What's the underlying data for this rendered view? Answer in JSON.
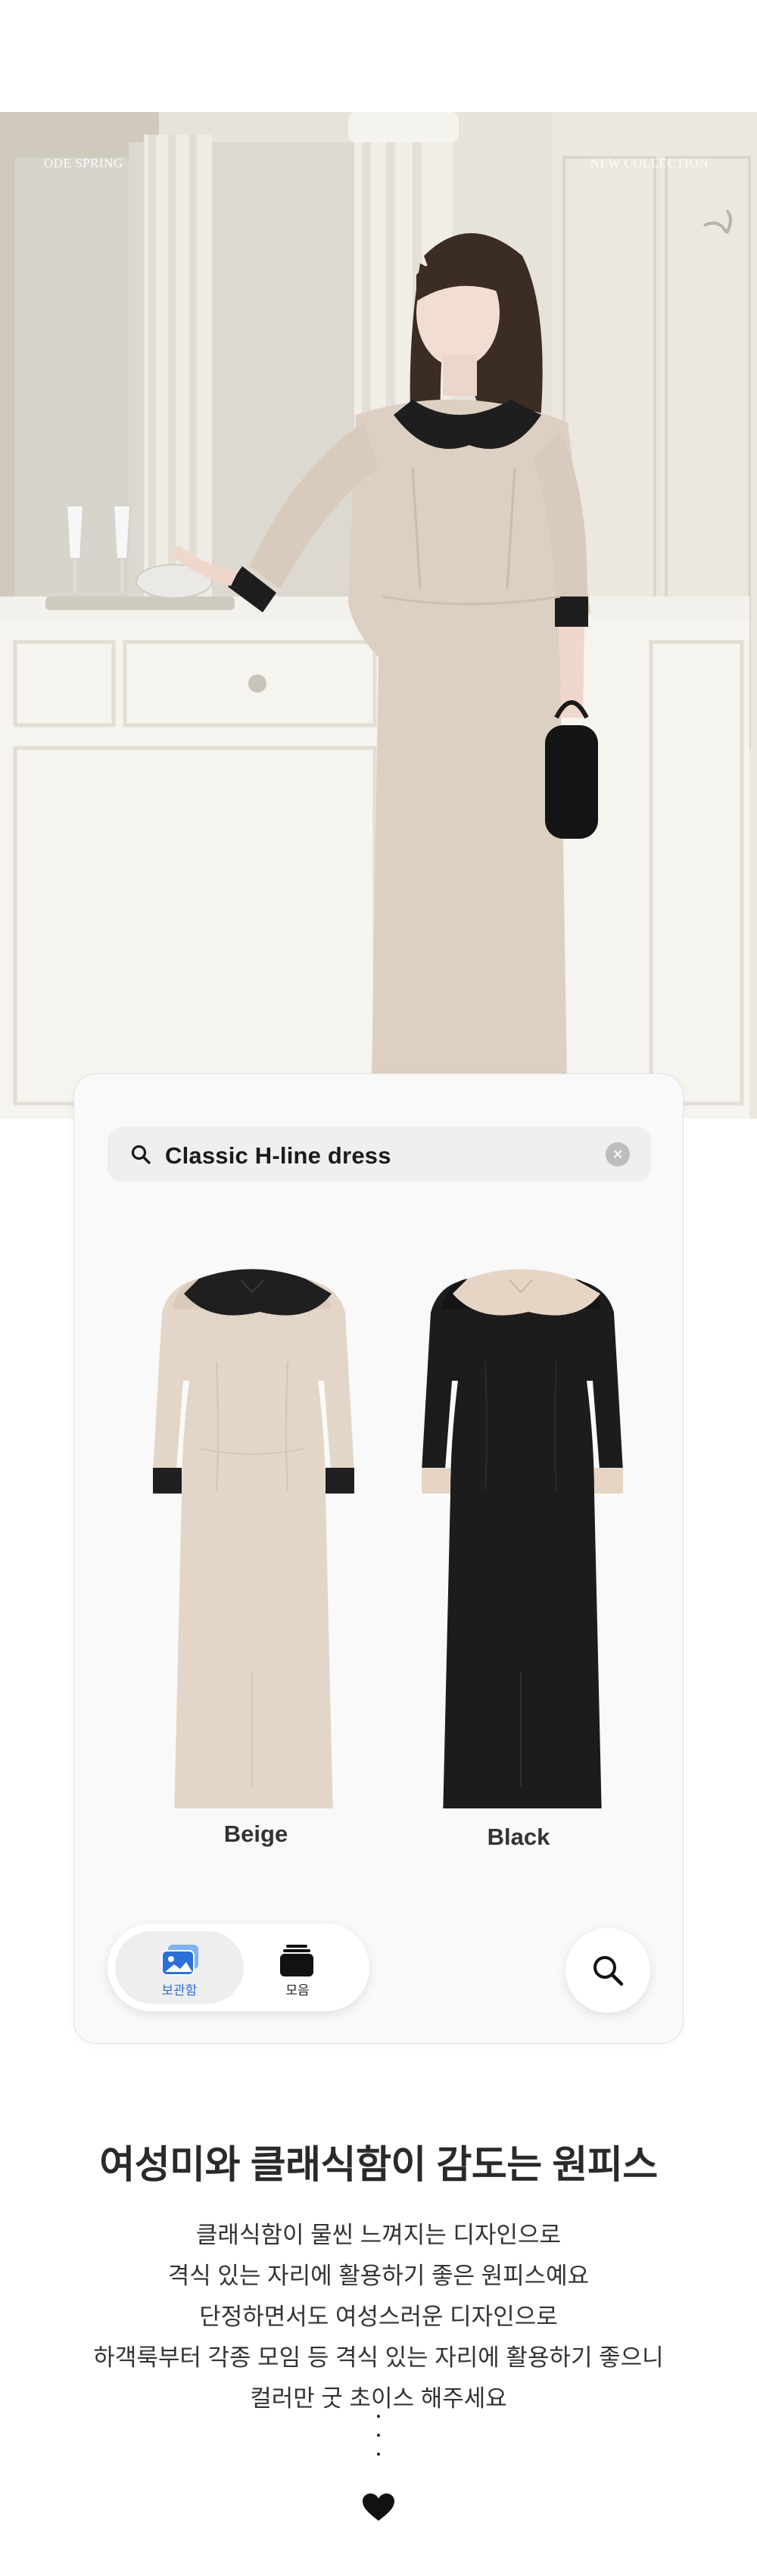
{
  "hero": {
    "left_tag": "ODE SPRING",
    "right_tag": "NEW COLLECTION"
  },
  "search": {
    "query": "Classic H-line dress",
    "clear_symbol": "×"
  },
  "products": [
    {
      "label": "Beige",
      "color": "#e3d5c7",
      "accent": "#1f1f1f"
    },
    {
      "label": "Black",
      "color": "#1c1c1c",
      "accent": "#e6d5c5"
    }
  ],
  "tabbar": {
    "saved_label": "보관함",
    "collection_label": "모음",
    "active_color": "#2d6fd8"
  },
  "description": {
    "headline": "여성미와 클래식함이 감도는 원피스",
    "lines": [
      "클래식함이 물씬 느껴지는 디자인으로",
      "격식 있는 자리에 활용하기 좋은 원피스예요",
      "단정하면서도 여성스러운 디자인으로",
      "하객룩부터 각종 모임 등 격식 있는 자리에 활용하기 좋으니",
      "컬러만 굿 초이스 해주세요"
    ],
    "end_symbol": "black-heart-icon"
  }
}
